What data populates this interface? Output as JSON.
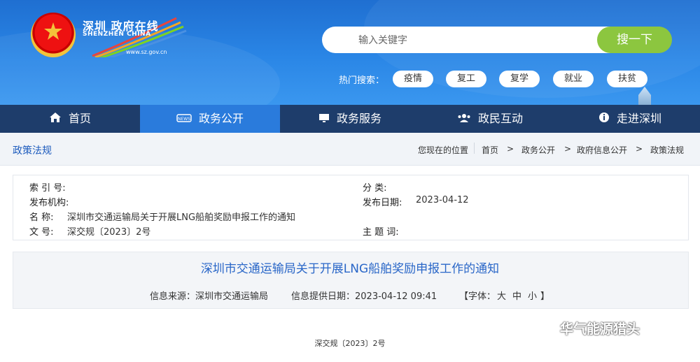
{
  "header": {
    "logo_cn": "深圳 政府在线",
    "logo_en": "SHENZHEN CHINA",
    "logo_url": "www.sz.gov.cn",
    "search_placeholder": "输入关键字",
    "search_button": "搜一下",
    "hot_label": "热门搜索：",
    "hot_tags": [
      "疫情",
      "复工",
      "复学",
      "就业",
      "扶贫"
    ]
  },
  "nav": {
    "items": [
      {
        "label": "首页",
        "icon": "home-icon"
      },
      {
        "label": "政务公开",
        "icon": "news-icon"
      },
      {
        "label": "政务服务",
        "icon": "monitor-icon"
      },
      {
        "label": "政民互动",
        "icon": "users-icon"
      },
      {
        "label": "走进深圳",
        "icon": "info-icon"
      }
    ],
    "active_index": 1
  },
  "breadcrumb": {
    "section": "政策法规",
    "prefix": "您现在的位置",
    "items": [
      "首页",
      "政务公开",
      "政府信息公开",
      "政策法规"
    ],
    "sep": ">"
  },
  "meta": {
    "index_no_label": "索 引 号:",
    "index_no": "",
    "category_label": "分      类:",
    "category": "",
    "publisher_label": "发布机构:",
    "publisher": "",
    "date_label": "发布日期:",
    "date": "2023-04-12",
    "name_label": "名    称:",
    "name": "深圳市交通运输局关于开展LNG船舶奖励申报工作的通知",
    "docno_label": "文    号:",
    "docno": "深交规〔2023〕2号",
    "subject_label": "主 题 词:",
    "subject": ""
  },
  "article": {
    "title": "深圳市交通运输局关于开展LNG船舶奖励申报工作的通知",
    "source": "信息来源：深圳市交通运输局",
    "provided": "信息提供日期：2023-04-12 09:41",
    "font_label": "【字体：",
    "font_sizes": [
      "大",
      "中",
      "小"
    ],
    "font_end": "】",
    "doc_number": "深交规〔2023〕2号"
  },
  "watermark": "华气能源猎头",
  "colors": {
    "header_blue": "#2a86e6",
    "nav_dark": "#1e3d6b",
    "nav_active": "#2a7bdc",
    "search_green": "#8cc63f",
    "title_blue": "#2a67c8"
  }
}
